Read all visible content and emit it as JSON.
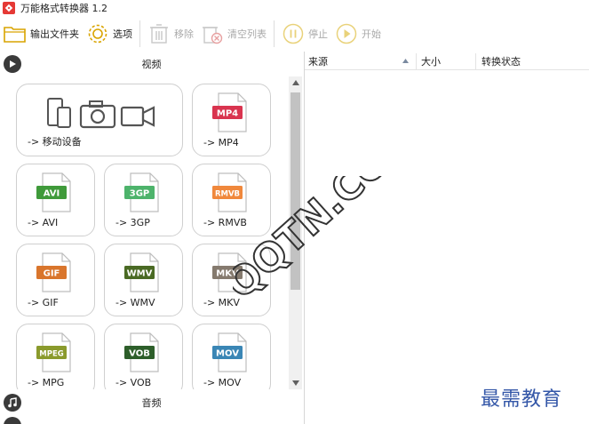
{
  "window": {
    "title": "万能格式转换器 1.2"
  },
  "toolbar": {
    "output_folder": "输出文件夹",
    "options": "选项",
    "remove": "移除",
    "clear_list": "清空列表",
    "stop": "停止",
    "start": "开始"
  },
  "sections": {
    "video": "视频",
    "audio": "音频"
  },
  "video_targets": [
    {
      "caption": "-> 移动设备",
      "badge": ""
    },
    {
      "caption": "-> MP4",
      "badge": "MP4"
    },
    {
      "caption": "-> AVI",
      "badge": "AVI"
    },
    {
      "caption": "-> 3GP",
      "badge": "3GP"
    },
    {
      "caption": "-> RMVB",
      "badge": "RMVB"
    },
    {
      "caption": "-> GIF",
      "badge": "GIF"
    },
    {
      "caption": "-> WMV",
      "badge": "WMV"
    },
    {
      "caption": "-> MKV",
      "badge": "MKV"
    },
    {
      "caption": "-> MPG",
      "badge": "MPEG"
    },
    {
      "caption": "-> VOB",
      "badge": "VOB"
    },
    {
      "caption": "-> MOV",
      "badge": "MOV"
    }
  ],
  "badge_colors": {
    "MP4": "#d9344f",
    "AVI": "#3f9a3a",
    "3GP": "#4db36b",
    "RMVB": "#f0883c",
    "GIF": "#d9752c",
    "WMV": "#4a6a24",
    "MKV": "#857a6e",
    "MPEG": "#8a9a2c",
    "VOB": "#2d5e2a",
    "MOV": "#3a86b5"
  },
  "file_list": {
    "columns": [
      "来源",
      "大小",
      "转换状态"
    ]
  },
  "watermark": "QQTN.COM",
  "brand": "最需教育"
}
